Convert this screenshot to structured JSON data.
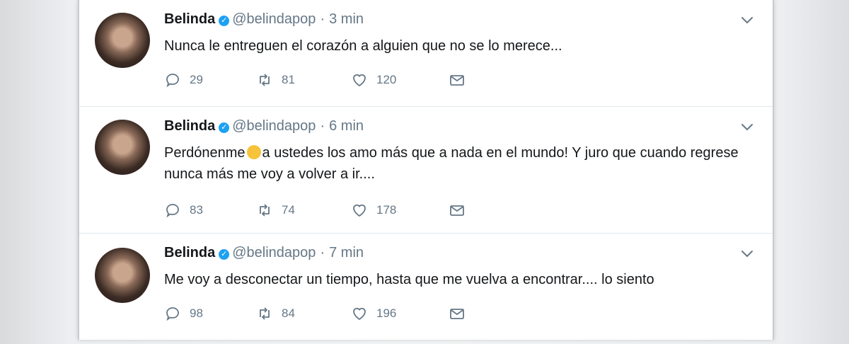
{
  "tweets": [
    {
      "name": "Belinda",
      "handle": "@belindapop",
      "separator": "·",
      "time": "3 min",
      "text": "Nunca le entreguen el corazón a alguien que no se lo merece...",
      "replies": "29",
      "retweets": "81",
      "likes": "120"
    },
    {
      "name": "Belinda",
      "handle": "@belindapop",
      "separator": "·",
      "time": "6 min",
      "text_before_emoji": "Perdónenme",
      "emoji": "crying-face-emoji",
      "text_after_emoji": "a ustedes los amo más que a nada en el mundo! Y juro que cuando regrese nunca más me voy a volver a ir....",
      "replies": "83",
      "retweets": "74",
      "likes": "178"
    },
    {
      "name": "Belinda",
      "handle": "@belindapop",
      "separator": "·",
      "time": "7 min",
      "text": "Me voy a desconectar un tiempo, hasta que me vuelva a encontrar.... lo siento",
      "replies": "98",
      "retweets": "84",
      "likes": "196"
    }
  ],
  "icons": {
    "verified": "verified-badge-icon",
    "reply": "reply-icon",
    "retweet": "retweet-icon",
    "like": "heart-icon",
    "dm": "envelope-icon",
    "menu": "chevron-down-icon"
  },
  "colors": {
    "verified": "#1da1f2",
    "text": "#14171a",
    "muted": "#657786",
    "divider": "#e1e8ed"
  }
}
